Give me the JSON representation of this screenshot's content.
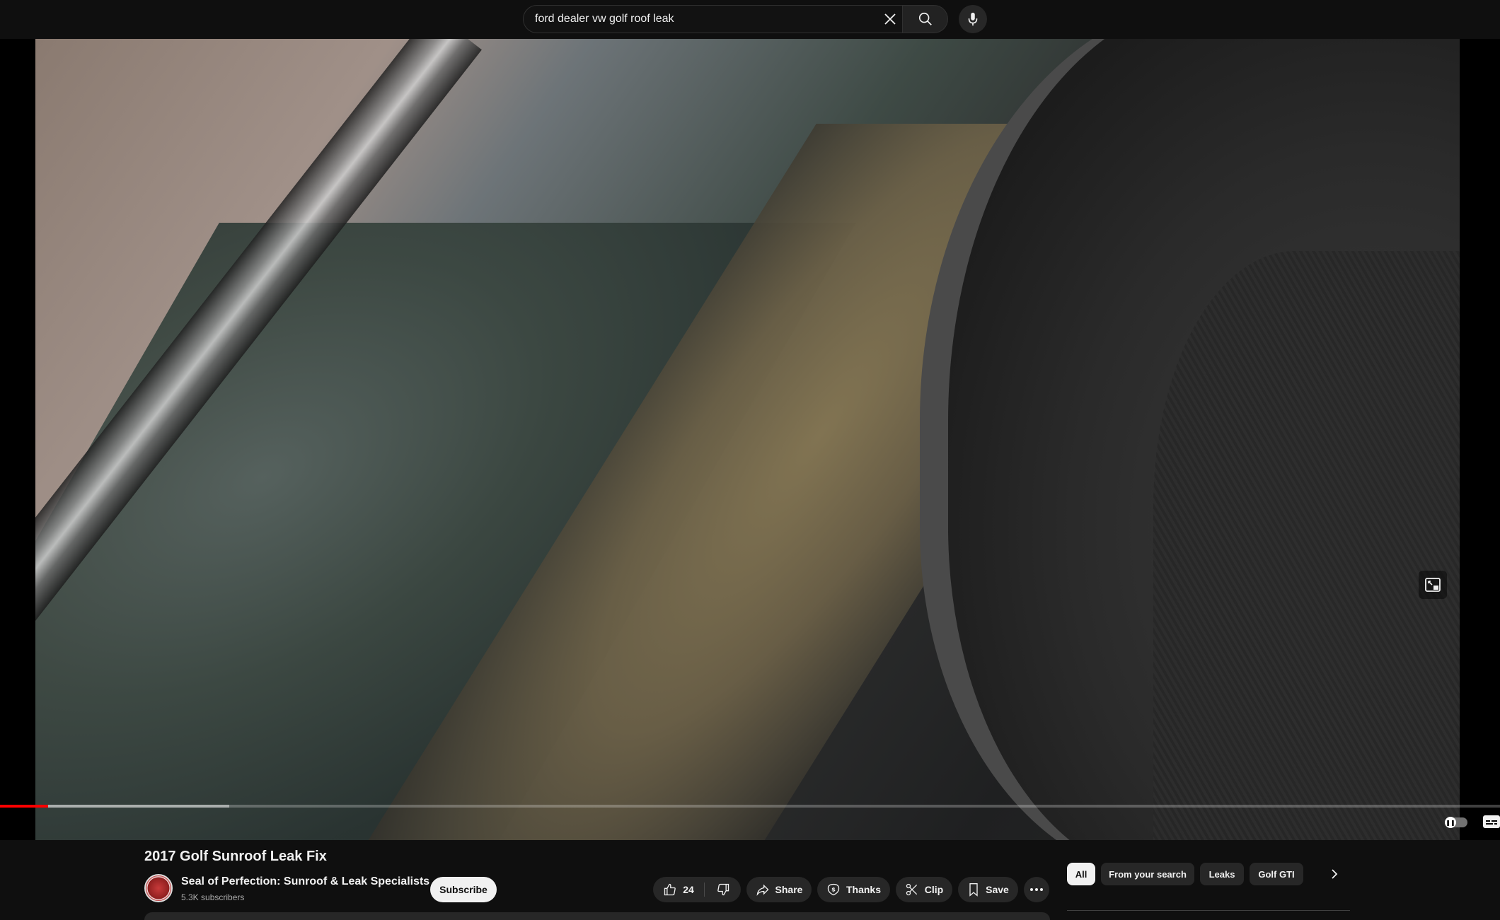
{
  "search": {
    "query": "ford dealer vw golf roof leak",
    "clear_icon": "close-icon",
    "submit_icon": "search-icon",
    "voice_icon": "mic-icon"
  },
  "player": {
    "progress_fraction": 0.032,
    "buffered_fraction": 0.153,
    "progress_color": "#ff0000",
    "autoplay_on": true
  },
  "video": {
    "title": "2017 Golf Sunroof Leak Fix",
    "channel": {
      "name": "Seal of Perfection: Sunroof & Leak Specialists",
      "subscribers": "5.3K subscribers"
    },
    "subscribe_label": "Subscribe",
    "actions": {
      "like_count": "24",
      "share_label": "Share",
      "thanks_label": "Thanks",
      "clip_label": "Clip",
      "save_label": "Save"
    }
  },
  "related_chips": {
    "items": [
      "All",
      "From your search",
      "Leaks",
      "Golf GTI"
    ],
    "active_index": 0
  },
  "colors": {
    "background": "#0f0f0f",
    "chip_active_bg": "#f1f1f1",
    "pill_bg": "#272727"
  }
}
